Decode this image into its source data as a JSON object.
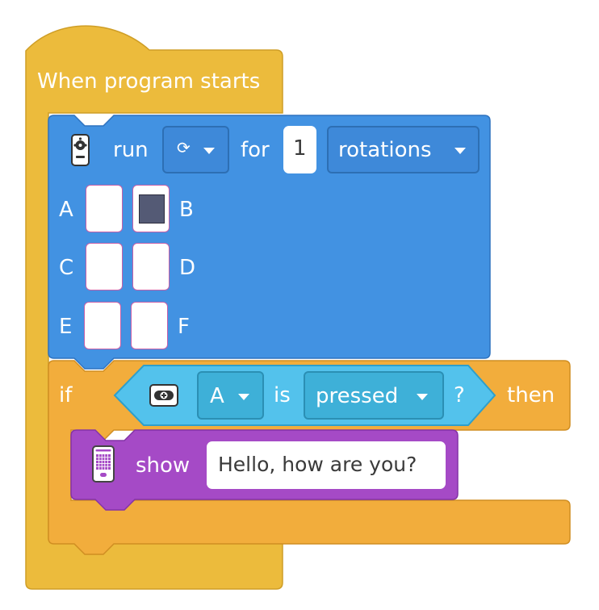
{
  "hat_block": {
    "label": "When program starts"
  },
  "motor_block": {
    "icon": "multi-motor-icon",
    "run_label": "run",
    "direction_icon": "clockwise-arrow-icon",
    "for_label": "for",
    "amount": "1",
    "unit": "rotations",
    "ports": [
      {
        "label": "A",
        "selected": false
      },
      {
        "label": "B",
        "selected": true
      },
      {
        "label": "C",
        "selected": false
      },
      {
        "label": "D",
        "selected": false
      },
      {
        "label": "E",
        "selected": false
      },
      {
        "label": "F",
        "selected": false
      }
    ]
  },
  "if_block": {
    "if_label": "if",
    "then_label": "then",
    "condition": {
      "icon": "force-sensor-icon",
      "port": "A",
      "is_label": "is",
      "state": "pressed",
      "question_mark": "?"
    }
  },
  "display_block": {
    "icon": "light-matrix-icon",
    "show_label": "show",
    "text": "Hello, how are you?"
  },
  "colors": {
    "events_yellow": "#ecbb3c",
    "motor_blue": "#4292e2",
    "control_orange": "#f2ad3c",
    "sensor_cyan": "#53c2ec",
    "display_purple": "#a54ac6"
  }
}
